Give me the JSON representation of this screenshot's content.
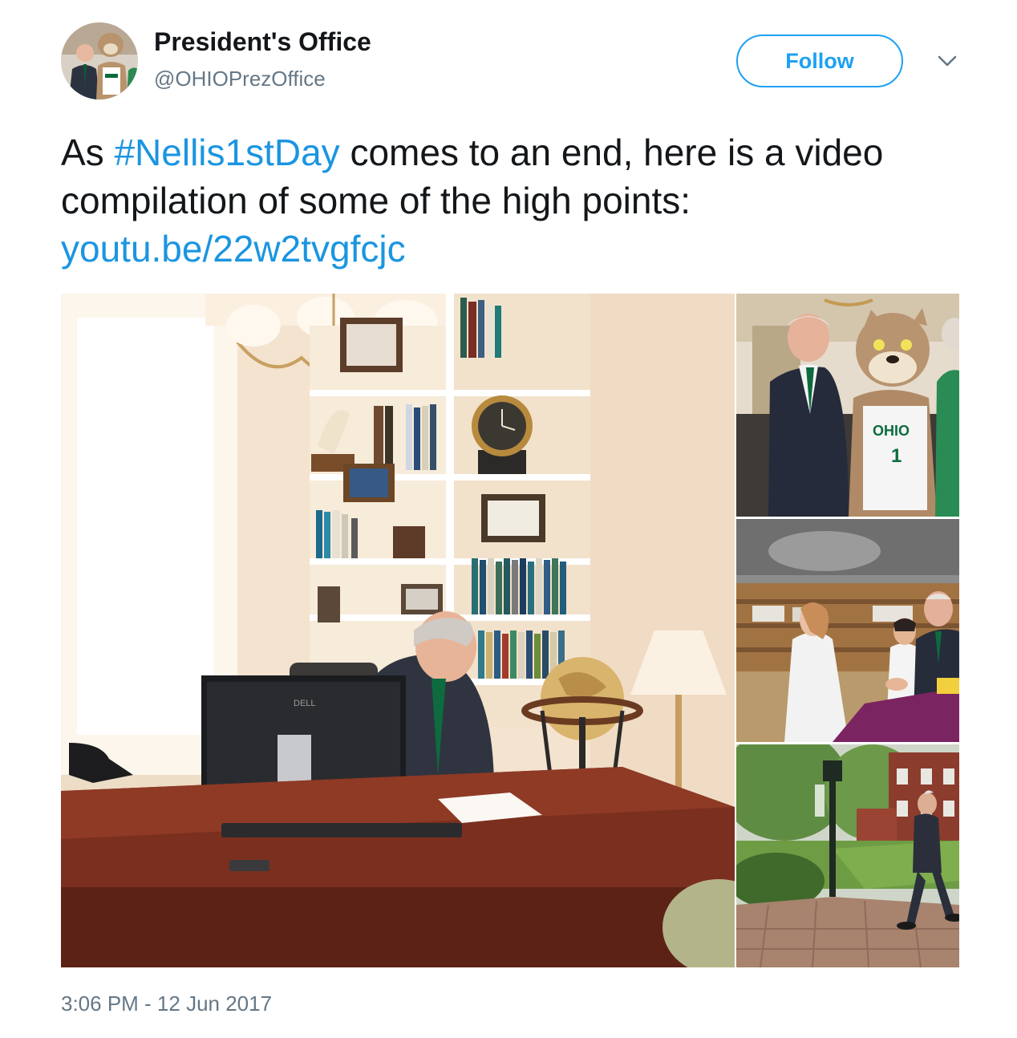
{
  "author": {
    "display_name": "President's Office",
    "handle": "@OHIOPrezOffice",
    "avatar_icon": "user-avatar-photo"
  },
  "actions": {
    "follow_label": "Follow",
    "menu_icon": "chevron-down-icon"
  },
  "tweet": {
    "text_before": "As ",
    "hashtag": "#Nellis1stDay",
    "text_after": " comes to an end, here is a video compilation of some of the high points: ",
    "link": "youtu.be/22w2tvgfcjc",
    "timestamp": "3:06 PM - 12 Jun 2017"
  },
  "media": {
    "monitor_brand": "DELL",
    "jersey_text": "OHIO",
    "jersey_number": "1"
  },
  "colors": {
    "link": "#1b95e0",
    "brand": "#1da1f2",
    "secondary_text": "#657786",
    "primary_text": "#14171a"
  }
}
